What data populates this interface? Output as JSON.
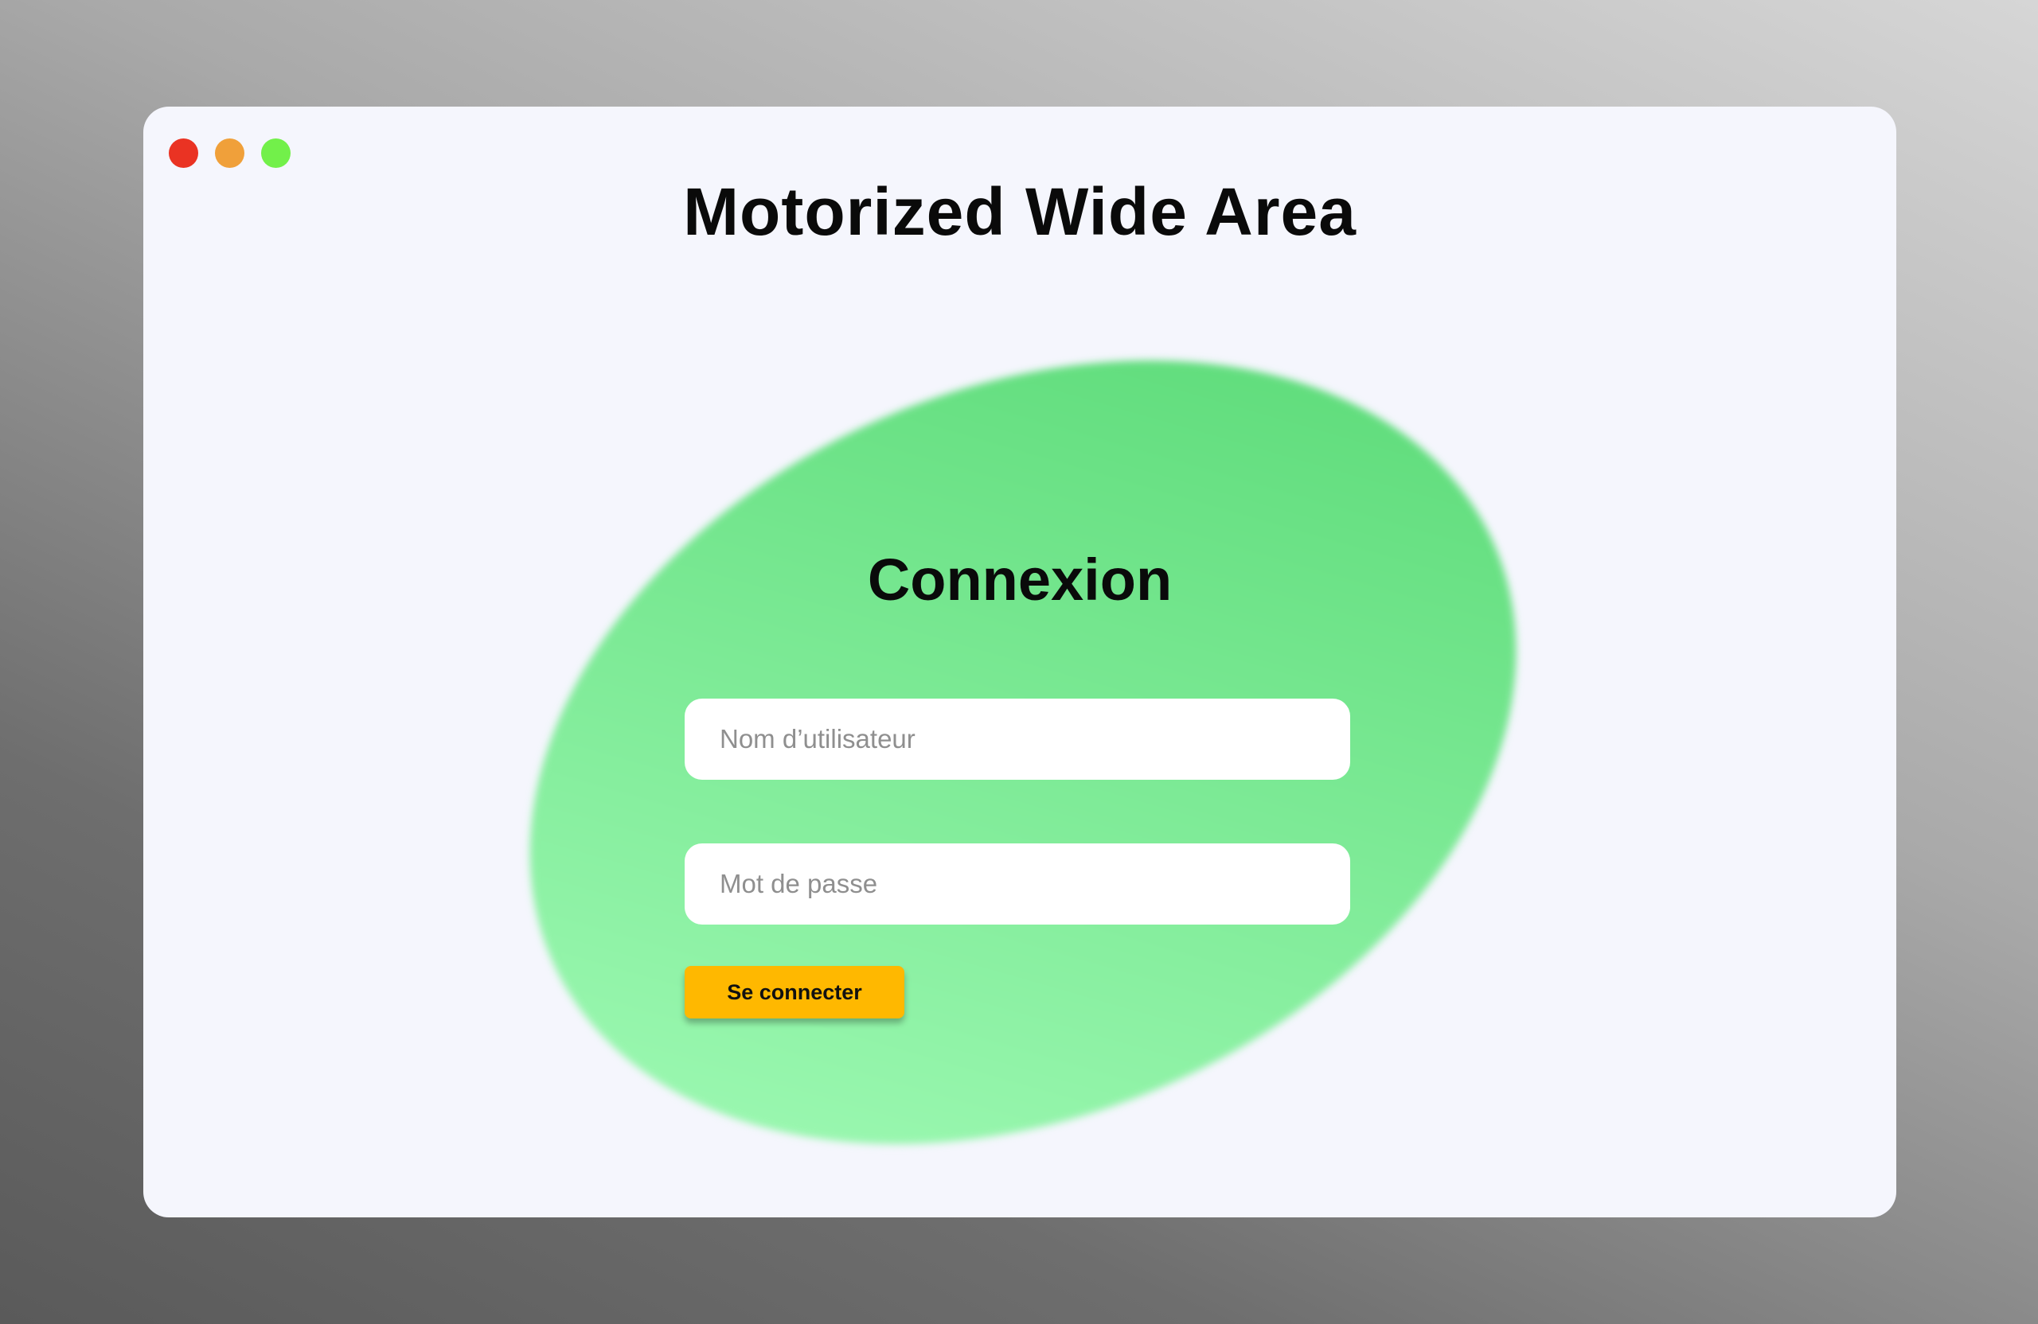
{
  "window": {
    "background": "#f5f6fd",
    "controls": [
      {
        "name": "close",
        "color": "#ea3323"
      },
      {
        "name": "minimize",
        "color": "#f0a03a"
      },
      {
        "name": "maximize",
        "color": "#72f04a"
      }
    ]
  },
  "app": {
    "title": "Motorized Wide Area"
  },
  "login": {
    "title": "Connexion",
    "username": {
      "value": "",
      "placeholder": "Nom d’utilisateur"
    },
    "password": {
      "value": "",
      "placeholder": "Mot de passe"
    },
    "submit_label": "Se connecter"
  },
  "colors": {
    "blob_light": "#a4fcb9",
    "blob_dark": "#56d873",
    "button": "#ffb800"
  }
}
